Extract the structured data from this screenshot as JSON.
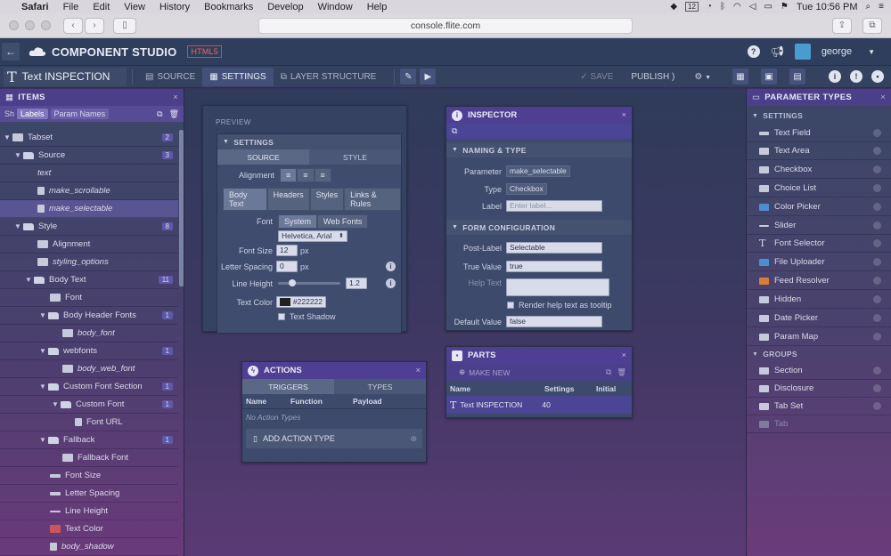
{
  "mac_menubar": {
    "apple": "",
    "items": [
      "Safari",
      "File",
      "Edit",
      "View",
      "History",
      "Bookmarks",
      "Develop",
      "Window",
      "Help"
    ],
    "clock": "Tue 10:56 PM",
    "calendar_day": "12"
  },
  "browser": {
    "url": "console.flite.com"
  },
  "app": {
    "title": "COMPONENT STUDIO",
    "badge": "HTML5",
    "user": "george",
    "help_icon": "?"
  },
  "toolbar": {
    "component_title": "Text INSPECTION",
    "tabs": [
      {
        "label": "SOURCE"
      },
      {
        "label": "SETTINGS"
      },
      {
        "label": "LAYER STRUCTURE"
      }
    ],
    "save_label": "SAVE",
    "publish_label": "PUBLISH"
  },
  "items_panel": {
    "title": "ITEMS",
    "show_label": "Sh",
    "filters": [
      "Labels",
      "Param Names"
    ],
    "rows": [
      {
        "label": "Tabset",
        "count": "2"
      },
      {
        "label": "Source",
        "count": "3"
      },
      {
        "label": "text",
        "count": ""
      },
      {
        "label": "make_scrollable",
        "count": ""
      },
      {
        "label": "make_selectable",
        "count": ""
      },
      {
        "label": "Style",
        "count": "8"
      },
      {
        "label": "Alignment",
        "count": ""
      },
      {
        "label": "styling_options",
        "count": ""
      },
      {
        "label": "Body Text",
        "count": "11"
      },
      {
        "label": "Font",
        "count": ""
      },
      {
        "label": "Body Header Fonts",
        "count": "1"
      },
      {
        "label": "body_font",
        "count": ""
      },
      {
        "label": "webfonts",
        "count": "1"
      },
      {
        "label": "body_web_font",
        "count": ""
      },
      {
        "label": "Custom Font Section",
        "count": "1"
      },
      {
        "label": "Custom Font",
        "count": "1"
      },
      {
        "label": "Font URL",
        "count": ""
      },
      {
        "label": "Fallback",
        "count": "1"
      },
      {
        "label": "Fallback Font",
        "count": ""
      },
      {
        "label": "Font Size",
        "count": ""
      },
      {
        "label": "Letter Spacing",
        "count": ""
      },
      {
        "label": "Line Height",
        "count": ""
      },
      {
        "label": "Text Color",
        "count": ""
      },
      {
        "label": "body_shadow",
        "count": ""
      }
    ]
  },
  "preview": {
    "label": "PREVIEW",
    "settings_title": "SETTINGS",
    "tabs": [
      "SOURCE",
      "STYLE"
    ],
    "alignment_label": "Alignment",
    "subtabs": [
      "Body Text",
      "Headers",
      "Styles",
      "Links & Rules"
    ],
    "font_label": "Font",
    "font_options": [
      "System",
      "Web Fonts"
    ],
    "font_value": "Helvetica, Arial",
    "font_size_label": "Font Size",
    "font_size_value": "12",
    "font_size_unit": "px",
    "letter_spacing_label": "Letter Spacing",
    "letter_spacing_value": "0",
    "letter_spacing_unit": "px",
    "line_height_label": "Line Height",
    "line_height_value": "1.2",
    "text_color_label": "Text Color",
    "text_color_value": "#222222",
    "text_shadow_label": "Text Shadow"
  },
  "inspector": {
    "title": "INSPECTOR",
    "naming_section": "NAMING & TYPE",
    "parameter_label": "Parameter",
    "parameter_value": "make_selectable",
    "type_label": "Type",
    "type_value": "Checkbox",
    "label_label": "Label",
    "label_placeholder": "Enter label...",
    "form_section": "FORM CONFIGURATION",
    "post_label_label": "Post-Label",
    "post_label_value": "Selectable",
    "true_value_label": "True Value",
    "true_value_value": "true",
    "help_text_label": "Help Text",
    "help_tooltip_label": "Render help text as tooltip",
    "default_value_label": "Default Value",
    "default_value_value": "false"
  },
  "actions": {
    "title": "ACTIONS",
    "tabs": [
      "TRIGGERS",
      "TYPES"
    ],
    "columns": [
      "Name",
      "Function",
      "Payload"
    ],
    "empty_text": "No Action Types",
    "add_label": "ADD ACTION TYPE"
  },
  "parts": {
    "title": "PARTS",
    "make_new_label": "MAKE NEW",
    "columns": [
      "Name",
      "Settings",
      "Initial"
    ],
    "rows": [
      {
        "name": "Text INSPECTION",
        "settings": "40",
        "initial": ""
      }
    ]
  },
  "param_types": {
    "title": "PARAMETER TYPES",
    "settings_group": "SETTINGS",
    "settings_items": [
      "Text Field",
      "Text Area",
      "Checkbox",
      "Choice List",
      "Color Picker",
      "Slider",
      "Font Selector",
      "File Uploader",
      "Feed Resolver",
      "Hidden",
      "Date Picker",
      "Param Map"
    ],
    "groups_group": "GROUPS",
    "groups_items": [
      "Section",
      "Disclosure",
      "Tab Set",
      "Tab"
    ]
  },
  "colors": {
    "accent_purple": "#4e3f92",
    "panel_blue": "#3d4a6c",
    "html5_badge": "#dd4444",
    "avatar": "#4a9bd0",
    "feed_icon": "#d97b3f"
  }
}
